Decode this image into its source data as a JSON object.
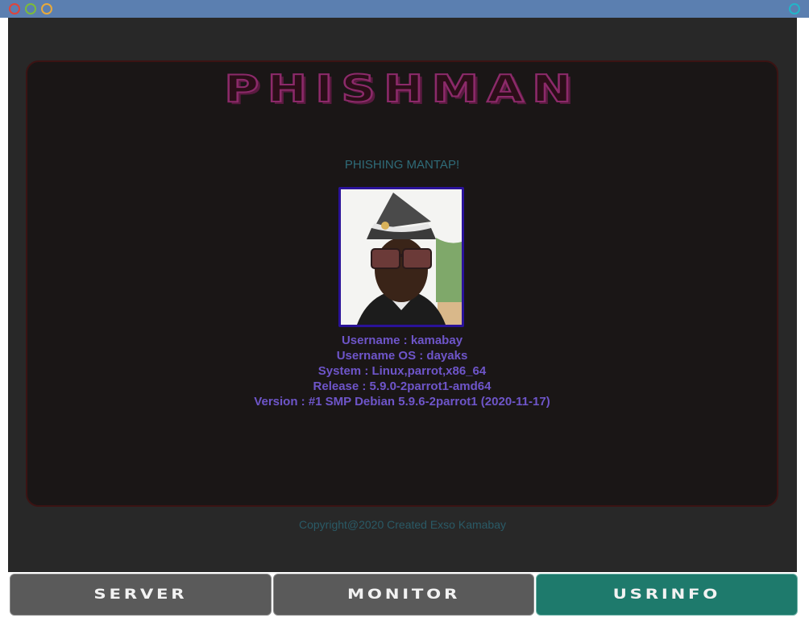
{
  "window": {
    "controls": [
      "close-icon",
      "minimize-icon",
      "maximize-icon",
      "pin-icon"
    ],
    "control_colors": {
      "close": "#e0443a",
      "minimize": "#7dbb3a",
      "maximize": "#e8a93a",
      "pin": "#22b5c8"
    }
  },
  "header": {
    "logo_text": "PHISHMAN",
    "tagline": "PHISHING MANTAP!"
  },
  "user_info": {
    "avatar": "user-avatar-photo",
    "username": "Username : kamabay",
    "username_os": "Username OS : dayaks",
    "system": "System : Linux,parrot,x86_64",
    "release": "Release : 5.9.0-2parrot1-amd64",
    "version": "Version : #1 SMP Debian 5.9.6-2parrot1 (2020-11-17)"
  },
  "footer": {
    "copyright": "Copyright@2020 Created Exso Kamabay"
  },
  "nav": {
    "server_label": "SERVER",
    "monitor_label": "MONITOR",
    "usrinfo_label": "USRINFO",
    "active": "USRINFO"
  },
  "colors": {
    "accent_active": "#1e7a6c",
    "button_default": "#5a5a5a",
    "info_text": "#6e55c9",
    "logo_outline": "#8c2a6a"
  }
}
